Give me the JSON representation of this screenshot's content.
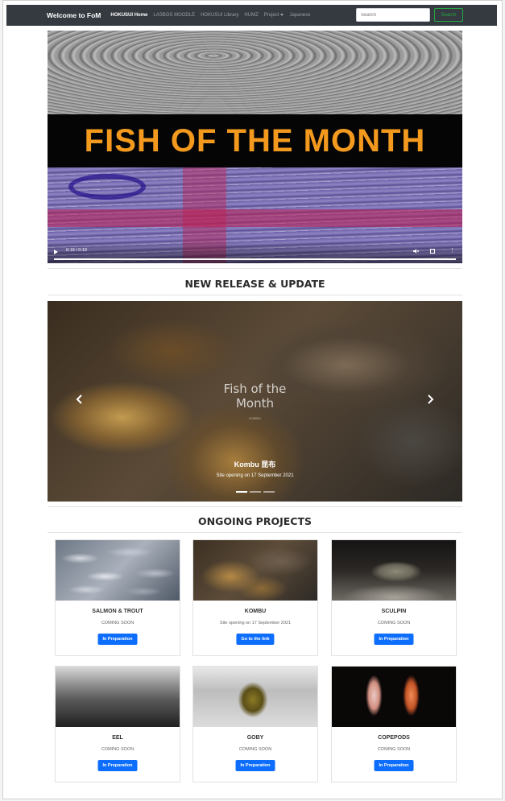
{
  "navbar": {
    "brand": "Welcome to FoM",
    "links": [
      {
        "label": "HOKUSUI Home",
        "active": true
      },
      {
        "label": "LASBOS MOODLE",
        "active": false
      },
      {
        "label": "HOKUSUI Library",
        "active": false
      },
      {
        "label": "HUMZ",
        "active": false
      },
      {
        "label": "Project",
        "active": false,
        "dropdown": true
      },
      {
        "label": "Japanese",
        "active": false
      }
    ],
    "search_placeholder": "Search",
    "search_button": "Search"
  },
  "video": {
    "title": "FISH OF THE MONTH",
    "time": "0:19 / 0:19",
    "progress_fraction": 1.0
  },
  "sections": {
    "new_release": "NEW RELEASE & UPDATE",
    "ongoing": "ONGOING PROJECTS"
  },
  "carousel": {
    "heading": "Fish of the\nMonth",
    "heading_sub": "KOMBU",
    "caption_title": "Kombu 昆布",
    "caption_text": "Site opening on 17 September 2021",
    "indicator_count": 3,
    "active_index": 0
  },
  "projects": [
    {
      "title": "SALMON & TROUT",
      "status": "COMING SOON",
      "button": "In Preparation",
      "image": "salmon"
    },
    {
      "title": "KOMBU",
      "status": "Site opening on 17 September 2021",
      "button": "Go to the link",
      "image": "kombu"
    },
    {
      "title": "SCULPIN",
      "status": "COMING SOON",
      "button": "In Preparation",
      "image": "sculpin"
    },
    {
      "title": "EEL",
      "status": "COMING SOON",
      "button": "In Preparation",
      "image": "eel"
    },
    {
      "title": "GOBY",
      "status": "COMING SOON",
      "button": "In Preparation",
      "image": "goby"
    },
    {
      "title": "COPEPODS",
      "status": "COMING SOON",
      "button": "In Preparation",
      "image": "copepods"
    }
  ],
  "icons": {
    "play": "play-icon",
    "mute": "volume-muted-icon",
    "fullscreen": "fullscreen-icon",
    "more": "more-vertical-icon",
    "prev": "chevron-left-icon",
    "next": "chevron-right-icon"
  },
  "colors": {
    "navbar_bg": "#343a40",
    "title_orange": "#f39a1e",
    "primary_button": "#0d6efd",
    "search_green": "#28a745"
  }
}
